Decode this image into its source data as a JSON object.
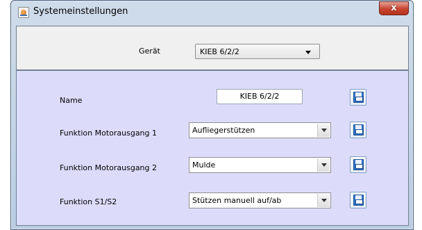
{
  "window": {
    "title": "Systemeinstellungen",
    "close_label": "x",
    "icon": "java-app-icon"
  },
  "device": {
    "label": "Gerät",
    "selected": "KIEB 6/2/2"
  },
  "settings": {
    "name": {
      "label": "Name",
      "value": "KIEB 6/2/2"
    },
    "motor1": {
      "label": "Funktion Motorausgang 1",
      "selected": "Aufliegerstützen"
    },
    "motor2": {
      "label": "Funktion Motorausgang 2",
      "selected": "Mulde"
    },
    "s1s2": {
      "label": "Funktion S1/S2",
      "selected": "Stützen manuell auf/ab"
    }
  },
  "colors": {
    "main_panel_bg": "#dcdcfa",
    "save_icon": "#2f74c8",
    "close_button": "#c7442e"
  }
}
